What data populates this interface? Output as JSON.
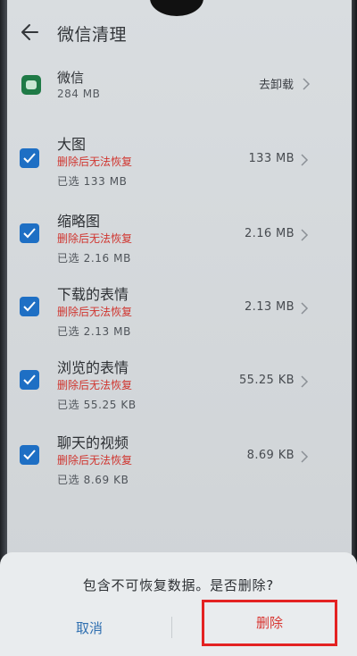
{
  "header": {
    "title": "微信清理"
  },
  "app": {
    "name": "微信",
    "size": "284 MB",
    "uninstall_label": "去卸载"
  },
  "items": [
    {
      "title": "大图",
      "warning": "删除后无法恢复",
      "selected": "已选 133 MB",
      "size": "133 MB",
      "checked": true
    },
    {
      "title": "缩略图",
      "warning": "删除后无法恢复",
      "selected": "已选 2.16 MB",
      "size": "2.16 MB",
      "checked": true
    },
    {
      "title": "下载的表情",
      "warning": "删除后无法恢复",
      "selected": "已选 2.13 MB",
      "size": "2.13 MB",
      "checked": true
    },
    {
      "title": "浏览的表情",
      "warning": "删除后无法恢复",
      "selected": "已选 55.25 KB",
      "size": "55.25 KB",
      "checked": true
    },
    {
      "title": "聊天的视频",
      "warning": "删除后无法恢复",
      "selected": "已选 8.69 KB",
      "size": "8.69 KB",
      "checked": true
    }
  ],
  "dialog": {
    "message": "包含不可恢复数据。是否删除?",
    "cancel_label": "取消",
    "delete_label": "删除"
  },
  "colors": {
    "accent": "#1e6fc4",
    "warning": "#d0352f",
    "highlight_box": "#e32222",
    "background": "#d6dadd"
  },
  "icons": [
    "back-arrow-icon",
    "wechat-icon",
    "chevron-right-icon",
    "checkbox-checked-icon"
  ]
}
